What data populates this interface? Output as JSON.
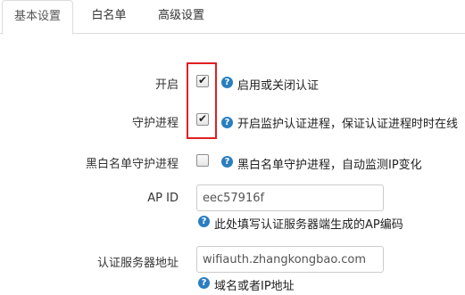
{
  "tabs": [
    {
      "label": "基本设置"
    },
    {
      "label": "白名单"
    },
    {
      "label": "高级设置"
    }
  ],
  "fields": {
    "enable": {
      "label": "开启",
      "checked": true,
      "help": "启用或关闭认证"
    },
    "guard": {
      "label": "守护进程",
      "checked": true,
      "help": "开启监护认证进程，保证认证进程时时在线"
    },
    "blacklist_guard": {
      "label": "黑白名单守护进程",
      "checked": false,
      "help": "黑白名单守护进程，自动监测IP变化"
    },
    "ap_id": {
      "label": "AP ID",
      "value": "eec57916f",
      "help": "此处填写认证服务器端生成的AP编码"
    },
    "auth_server": {
      "label": "认证服务器地址",
      "value": "wifiauth.zhangkongbao.com",
      "help": "域名或者IP地址"
    }
  },
  "icons": {
    "help": "question-circle-icon",
    "check": "checkmark-icon"
  },
  "colors": {
    "accent": "#2a7ebf",
    "highlight": "#e02020"
  }
}
